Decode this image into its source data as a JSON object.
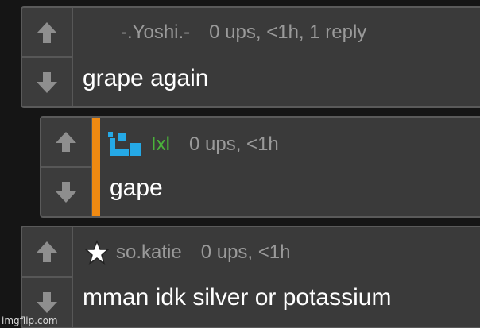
{
  "comments": [
    {
      "username": "-.Yoshi.-",
      "meta": "0 ups, <1h, 1 reply",
      "text": "grape again",
      "avatar_icon": "none",
      "username_color": "#9a9a9a"
    },
    {
      "username": "Ixl",
      "meta": "0 ups, <1h",
      "text": "gape",
      "avatar_icon": "blue-bracket-icon",
      "username_color": "#4ab23a",
      "accent_color": "#f08a12"
    },
    {
      "username": "so.katie",
      "meta": "0 ups, <1h",
      "text": "mman idk silver or potassium",
      "avatar_icon": "star-icon",
      "username_color": "#9a9a9a"
    }
  ],
  "watermark": "imgflip.com"
}
